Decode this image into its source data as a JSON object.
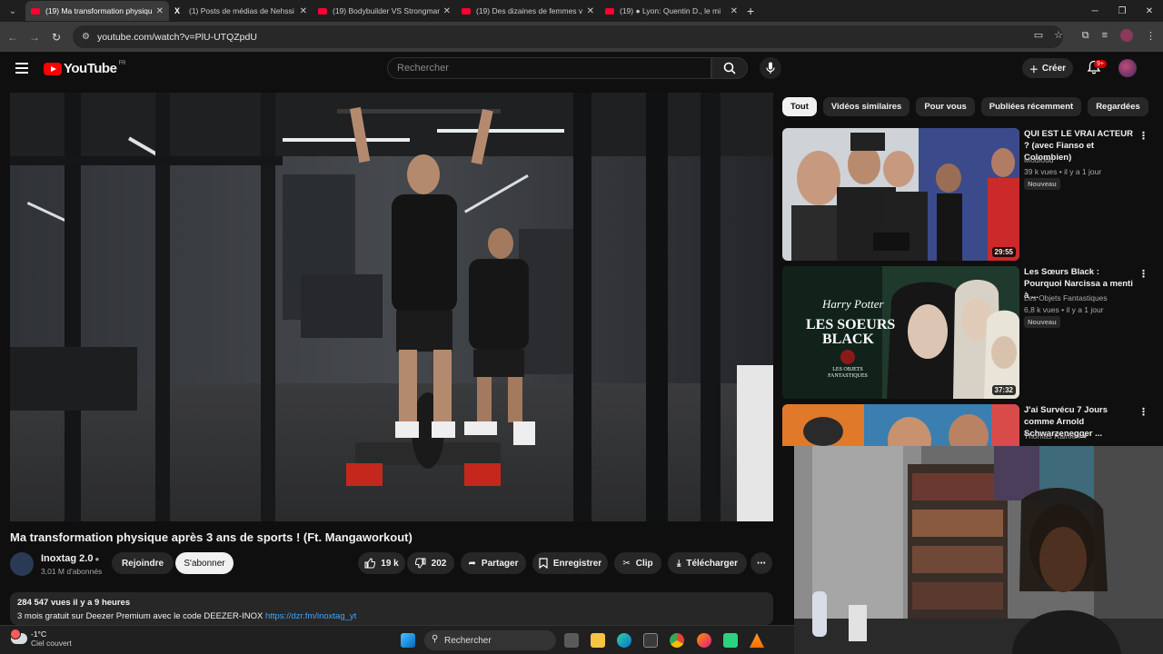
{
  "browser": {
    "tabs": [
      {
        "title": "(19) Ma transformation physique",
        "active": true,
        "icon": "youtube-icon"
      },
      {
        "title": "(1) Posts de médias de Nehssi",
        "active": false,
        "icon": "x-icon"
      },
      {
        "title": "(19) Bodybuilder VS Strongman",
        "active": false,
        "icon": "youtube-icon"
      },
      {
        "title": "(19) Des dizaines de femmes v",
        "active": false,
        "icon": "youtube-icon"
      },
      {
        "title": "(19) ● Lyon: Quentin D., le mi",
        "active": false,
        "icon": "youtube-icon"
      }
    ],
    "url": "youtube.com/watch?v=PlU-UTQZpdU"
  },
  "header": {
    "logo_text": "YouTube",
    "logo_region": "FR",
    "search_placeholder": "Rechercher",
    "create_label": "Créer",
    "notif_count": "9+"
  },
  "video": {
    "title": "Ma transformation physique après 3 ans de sports ! (Ft. Mangaworkout)",
    "channel": "Inoxtag 2.0",
    "subscribers": "3,01 M d'abonnés",
    "join_label": "Rejoindre",
    "subscribe_label": "S'abonner",
    "likes": "19 k",
    "dislikes": "202",
    "share_label": "Partager",
    "save_label": "Enregistrer",
    "clip_label": "Clip",
    "download_label": "Télécharger",
    "views_line": "284 547 vues  il y a 9 heures",
    "desc_line": "3 mois gratuit sur Deezer Premium avec le code DEEZER-INOX",
    "desc_link": "https://dzr.fm/inoxtag_yt"
  },
  "chips": [
    "Tout",
    "Vidéos similaires",
    "Pour vous",
    "Publiées récemment",
    "Regardées"
  ],
  "recommendations": [
    {
      "title": "QUI EST LE VRAI ACTEUR ? (avec Fianso et Colombien)",
      "channel": "Mouloud",
      "meta": "39 k vues • il y a 1 jour",
      "badge": "Nouveau",
      "duration": "29:55"
    },
    {
      "title": "Les Sœurs Black : Pourquoi Narcissa a menti à ...",
      "channel": "Les Objets Fantastiques",
      "meta": "6,8 k vues • il y a 1 jour",
      "badge": "Nouveau",
      "duration": "37:32",
      "thumb_text1": "Harry Potter",
      "thumb_text2": "LES SOEURS",
      "thumb_text3": "BLACK",
      "thumb_text4": "LES OBJETS FANTASTIQUES"
    },
    {
      "title": "J'ai Survécu 7 Jours comme Arnold Schwarzenegger ...",
      "channel": "Thomas Rainieri",
      "meta": "",
      "badge": "",
      "duration": ""
    }
  ],
  "taskbar": {
    "temp": "-1°C",
    "weather": "Ciel couvert",
    "search_label": "Rechercher"
  }
}
